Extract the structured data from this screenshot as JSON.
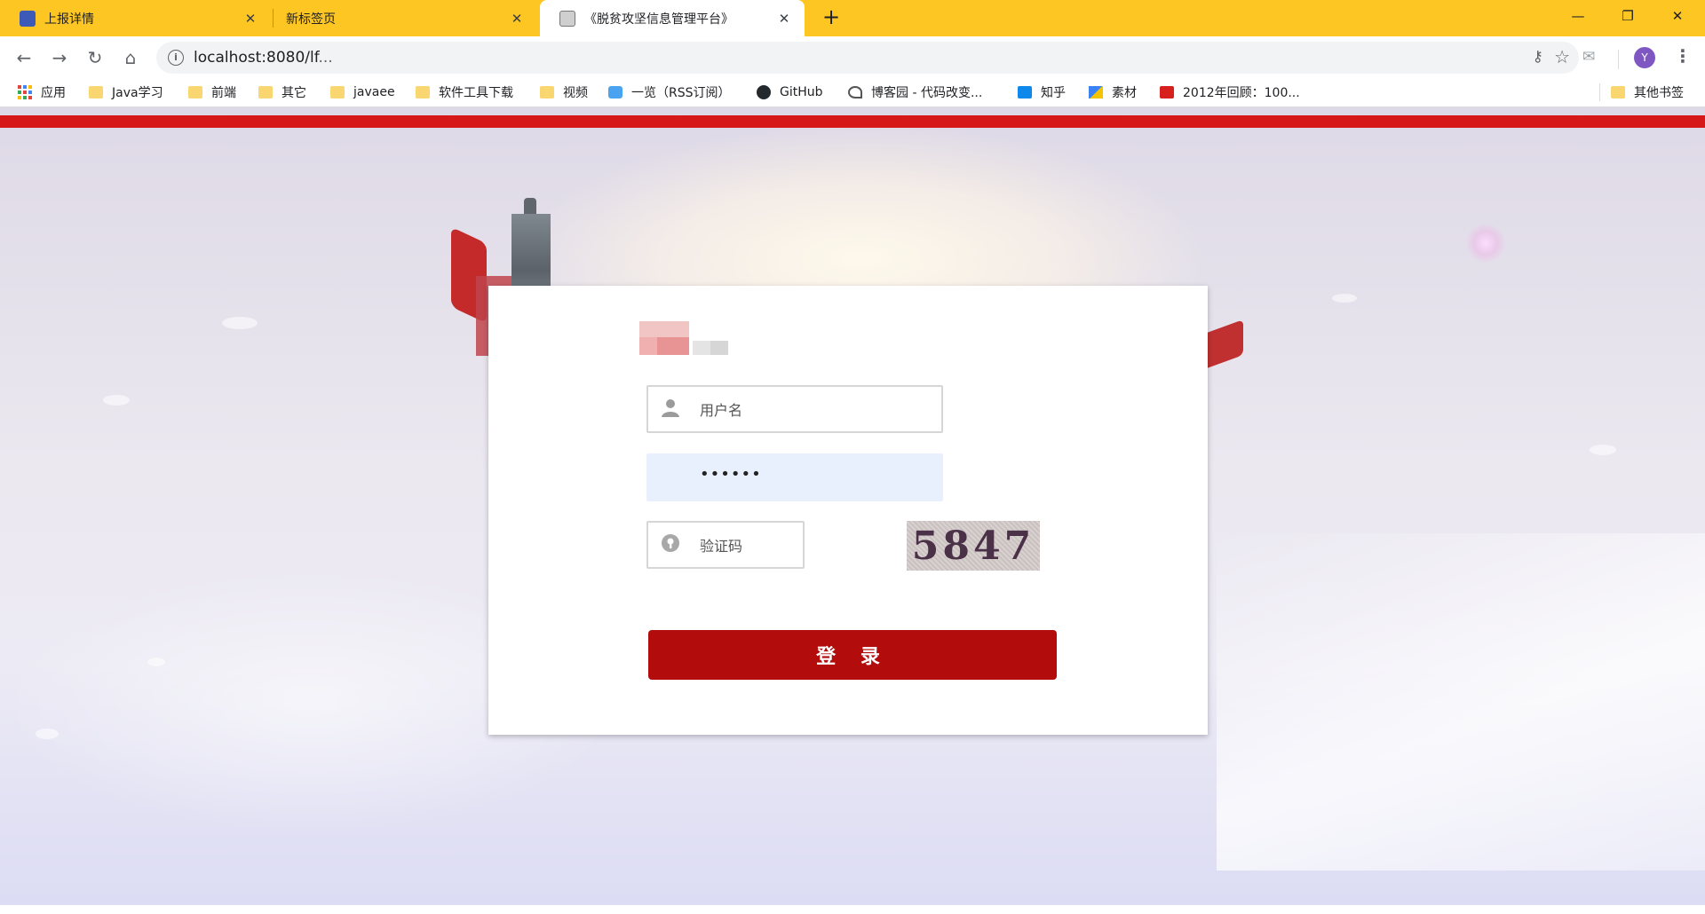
{
  "browser": {
    "tabs": [
      {
        "title": "上报详情",
        "close_label": "✕",
        "active": false
      },
      {
        "title": "新标签页",
        "close_label": "✕",
        "active": false
      },
      {
        "title": "《脱贫攻坚信息管理平台》",
        "close_label": "✕",
        "active": true
      }
    ],
    "new_tab_label": "+",
    "window_controls": {
      "minimize": "—",
      "restore": "❐",
      "close": "✕"
    },
    "toolbar": {
      "url_host": "localhost:8080/lf",
      "url_rest": "...",
      "back": "←",
      "forward": "→",
      "reload": "↻",
      "home": "⌂",
      "avatar_initial": "Y"
    },
    "bookmarks": [
      {
        "label": "应用",
        "icon": "apps-icon"
      },
      {
        "label": "Java学习",
        "icon": "folder-icon"
      },
      {
        "label": "前端",
        "icon": "folder-icon"
      },
      {
        "label": "其它",
        "icon": "folder-icon"
      },
      {
        "label": "javaee",
        "icon": "folder-icon"
      },
      {
        "label": "软件工具下载",
        "icon": "folder-icon"
      },
      {
        "label": "视频",
        "icon": "folder-icon"
      },
      {
        "label": "一览（RSS订阅）",
        "icon": "rss-icon"
      },
      {
        "label": "GitHub",
        "icon": "github-icon"
      },
      {
        "label": "博客园 - 代码改变...",
        "icon": "cnblogs-icon"
      },
      {
        "label": "知乎",
        "icon": "zhihu-icon"
      },
      {
        "label": "素材",
        "icon": "image-icon"
      },
      {
        "label": "2012年回顾：100...",
        "icon": "csdn-icon"
      },
      {
        "label": "其他书签",
        "icon": "folder-icon"
      }
    ]
  },
  "login": {
    "username_placeholder": "用户名",
    "password_value": "••••••",
    "captcha_placeholder": "验证码",
    "captcha_text": "5847",
    "submit_label": "登 录"
  },
  "colors": {
    "tabstrip": "#fdc623",
    "top_bar": "#d71819",
    "login_button": "#b20c0c"
  }
}
